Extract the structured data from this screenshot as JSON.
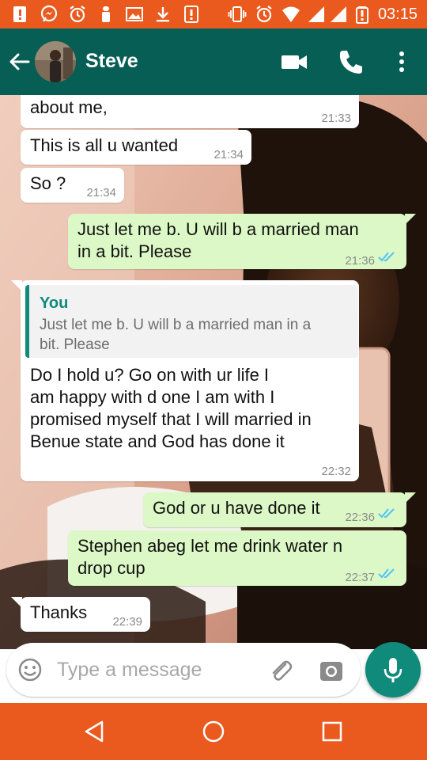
{
  "status_bar": {
    "time": "03:15",
    "icons": [
      "alert-icon",
      "messenger-icon",
      "alarm-icon",
      "notification-icon",
      "image-icon",
      "download-icon",
      "warning-icon",
      "vibrate-icon",
      "alarm-icon",
      "wifi-icon",
      "signal-icon",
      "signal-icon",
      "battery-low-icon"
    ]
  },
  "header": {
    "contact_name": "Steve",
    "icons": [
      "back-arrow-icon",
      "video-call-icon",
      "phone-call-icon",
      "more-options-icon"
    ]
  },
  "messages": [
    {
      "direction": "in",
      "text_lines": [
        "about me,"
      ],
      "time": "21:33"
    },
    {
      "direction": "in",
      "text_lines": [
        "This is all u wanted"
      ],
      "time": "21:34"
    },
    {
      "direction": "in",
      "text_lines": [
        "So ?"
      ],
      "time": "21:34"
    },
    {
      "direction": "out",
      "text_lines": [
        "Just let me b. U will b a married man",
        "in a bit. Please"
      ],
      "time": "21:36",
      "status": "read"
    },
    {
      "direction": "in",
      "quote": {
        "author": "You",
        "text_lines": [
          "Just let me b. U will b a married man in a",
          "bit. Please"
        ]
      },
      "text_lines": [
        "Do I hold u? Go on with ur life I",
        "am happy with d one I am with I",
        "promised myself that I will married in",
        "Benue state and God has done it"
      ],
      "time": "22:32"
    },
    {
      "direction": "out",
      "text_lines": [
        "God or u have done it"
      ],
      "time": "22:36",
      "status": "read"
    },
    {
      "direction": "out",
      "text_lines": [
        "Stephen abeg let me drink water n",
        "drop cup"
      ],
      "time": "22:37",
      "status": "read"
    },
    {
      "direction": "in",
      "text_lines": [
        "Thanks"
      ],
      "time": "22:39"
    }
  ],
  "composer": {
    "placeholder": "Type a message",
    "value": "",
    "icons": [
      "emoji-icon",
      "attach-icon",
      "camera-icon",
      "mic-icon"
    ]
  },
  "nav_bar": {
    "icons": [
      "back-triangle-icon",
      "home-circle-icon",
      "recents-square-icon"
    ]
  },
  "colors": {
    "status_bar": "#ea5a1f",
    "app_bar": "#075e54",
    "accent": "#0f8a7b",
    "outgoing_bubble": "#dcf8c6",
    "incoming_bubble": "#ffffff",
    "read_tick": "#4fc3f7",
    "nav_bar": "#ea5a1f"
  }
}
